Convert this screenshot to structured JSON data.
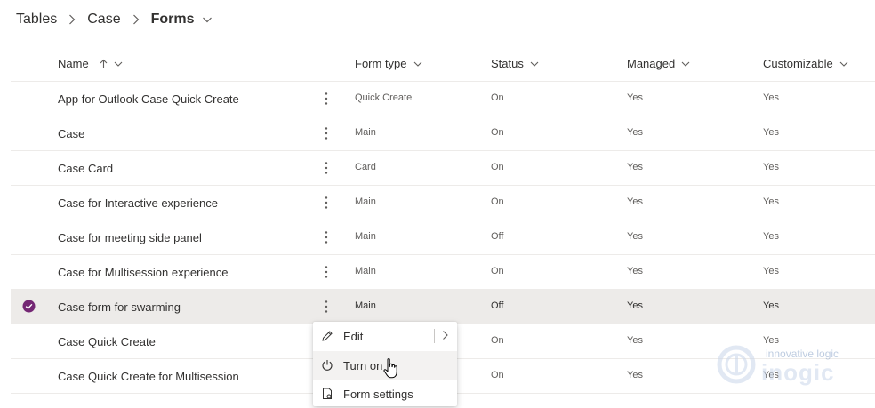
{
  "breadcrumb": {
    "items": [
      "Tables",
      "Case"
    ],
    "current": "Forms"
  },
  "columns": {
    "name": "Name",
    "form_type": "Form type",
    "status": "Status",
    "managed": "Managed",
    "customizable": "Customizable"
  },
  "rows": [
    {
      "name": "App for Outlook Case Quick Create",
      "form_type": "Quick Create",
      "status": "On",
      "managed": "Yes",
      "customizable": "Yes"
    },
    {
      "name": "Case",
      "form_type": "Main",
      "status": "On",
      "managed": "Yes",
      "customizable": "Yes"
    },
    {
      "name": "Case Card",
      "form_type": "Card",
      "status": "On",
      "managed": "Yes",
      "customizable": "Yes"
    },
    {
      "name": "Case for Interactive experience",
      "form_type": "Main",
      "status": "On",
      "managed": "Yes",
      "customizable": "Yes"
    },
    {
      "name": "Case for meeting side panel",
      "form_type": "Main",
      "status": "Off",
      "managed": "Yes",
      "customizable": "Yes"
    },
    {
      "name": "Case for Multisession experience",
      "form_type": "Main",
      "status": "On",
      "managed": "Yes",
      "customizable": "Yes"
    },
    {
      "name": "Case form for swarming",
      "form_type": "Main",
      "status": "Off",
      "managed": "Yes",
      "customizable": "Yes"
    },
    {
      "name": "Case Quick Create",
      "form_type": "",
      "status": "On",
      "managed": "Yes",
      "customizable": "Yes"
    },
    {
      "name": "Case Quick Create for Multisession",
      "form_type": "",
      "status": "On",
      "managed": "Yes",
      "customizable": "Yes"
    }
  ],
  "selected_row": 6,
  "context_menu": {
    "edit": "Edit",
    "turn_on": "Turn on",
    "form_settings": "Form settings"
  },
  "watermark": {
    "tagline": "innovative logic",
    "brand": "inogic"
  },
  "colors": {
    "accent": "#742774",
    "selected_bg": "#edebe9",
    "divider": "#edebe9"
  }
}
